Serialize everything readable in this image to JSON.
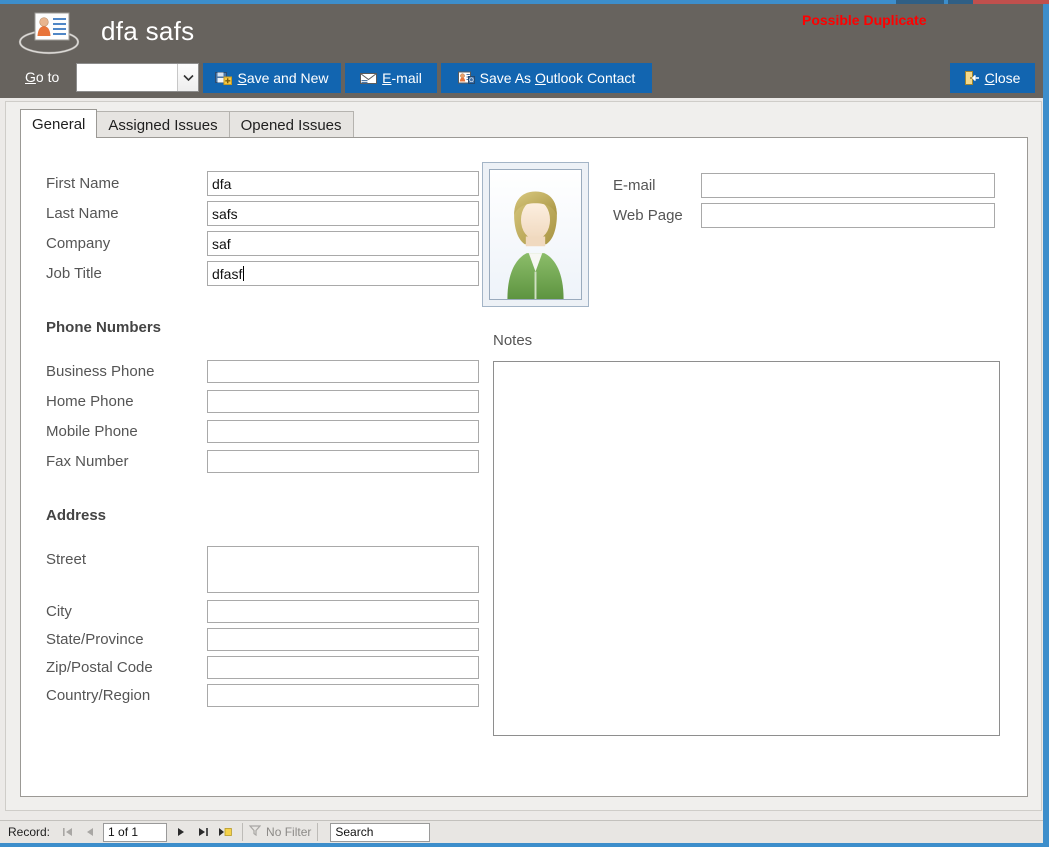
{
  "window": {
    "title": "dfa safs",
    "app_icon": "contact-card-icon",
    "duplicate_warning": "Possible Duplicate",
    "duplicate_warning_color": "#ff0000",
    "header_bg": "#67635e",
    "accent_color": "#3d8ecb",
    "accent_red": "#c0504d"
  },
  "toolbar": {
    "goto_label_prefix": "G",
    "goto_label_rest": "o to",
    "goto_combo_value": "",
    "buttons": [
      {
        "id": "save-and-new",
        "accel": "S",
        "label_before": "",
        "label_after": "ave and New",
        "icon": "save-new-icon",
        "color": "#1265b0"
      },
      {
        "id": "email",
        "accel": "E",
        "label_before": "",
        "label_after": "-mail",
        "icon": "envelope-icon",
        "color": "#1265b0"
      },
      {
        "id": "outlook-contact",
        "accel": "O",
        "label_before": "Save As ",
        "label_after": "utlook Contact",
        "icon": "outlook-contact-icon",
        "color": "#1265b0"
      },
      {
        "id": "close",
        "accel": "C",
        "label_before": "",
        "label_after": "lose",
        "icon": "close-door-icon",
        "color": "#1265b0"
      }
    ]
  },
  "tabs": [
    {
      "id": "general",
      "label": "General",
      "active": true
    },
    {
      "id": "assigned-issues",
      "label": "Assigned Issues",
      "active": false
    },
    {
      "id": "opened-issues",
      "label": "Opened Issues",
      "active": false
    }
  ],
  "form": {
    "identity": {
      "first_name_label": "First Name",
      "first_name_value": "dfa",
      "last_name_label": "Last Name",
      "last_name_value": "safs",
      "company_label": "Company",
      "company_value": "saf",
      "job_title_label": "Job Title",
      "job_title_value": "dfasf",
      "job_title_focused": true
    },
    "contact": {
      "email_label": "E-mail",
      "email_value": "",
      "web_page_label": "Web Page",
      "web_page_value": ""
    },
    "photo": {
      "alt": "contact-photo-placeholder"
    },
    "phone": {
      "heading": "Phone Numbers",
      "rows": [
        {
          "label": "Business Phone",
          "value": ""
        },
        {
          "label": "Home Phone",
          "value": ""
        },
        {
          "label": "Mobile Phone",
          "value": ""
        },
        {
          "label": "Fax Number",
          "value": ""
        }
      ]
    },
    "address": {
      "heading": "Address",
      "street_label": "Street",
      "street_value": "",
      "rows": [
        {
          "label": "City",
          "value": ""
        },
        {
          "label": "State/Province",
          "value": ""
        },
        {
          "label": "Zip/Postal Code",
          "value": ""
        },
        {
          "label": "Country/Region",
          "value": ""
        }
      ]
    },
    "notes": {
      "label": "Notes",
      "value": ""
    }
  },
  "statusbar": {
    "record_label": "Record:",
    "record_position": "1 of 1",
    "first_icon": "first-record-icon",
    "prev_icon": "previous-record-icon",
    "next_icon": "next-record-icon",
    "last_icon": "last-record-icon",
    "new_icon": "new-record-icon",
    "filter_icon": "filter-icon",
    "filter_label": "No Filter",
    "search_value": "Search"
  }
}
